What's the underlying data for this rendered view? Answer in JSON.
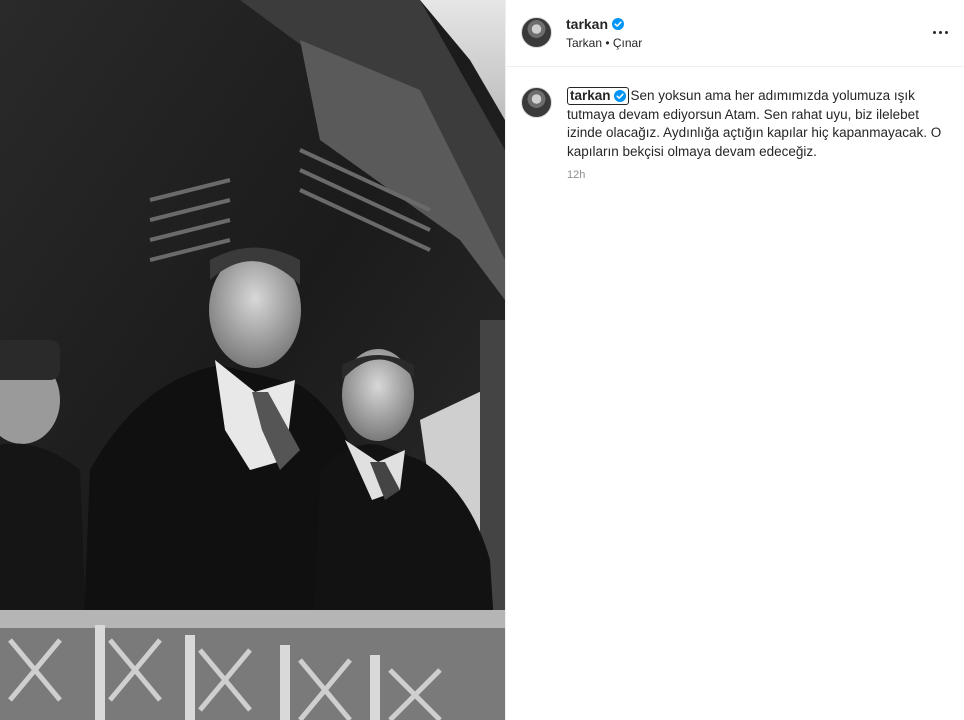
{
  "post": {
    "username": "tarkan",
    "verified": true,
    "subtitle": "Tarkan • Çınar",
    "more_icon": "more-horizontal-icon"
  },
  "caption": {
    "username": "tarkan",
    "text": "Sen yoksun ama her adımımızda yolumuza ışık tutmaya devam ediyorsun Atam. Sen rahat uyu, biz ilelebet izinde olacağız. Aydınlığa açtığın kapılar hiç kapanmayacak. O kapıların bekçisi olmaya devam edeceğiz.",
    "time": "12h"
  },
  "colors": {
    "verified_blue": "#0095f6",
    "text": "#262626",
    "muted": "#8e8e8e"
  }
}
